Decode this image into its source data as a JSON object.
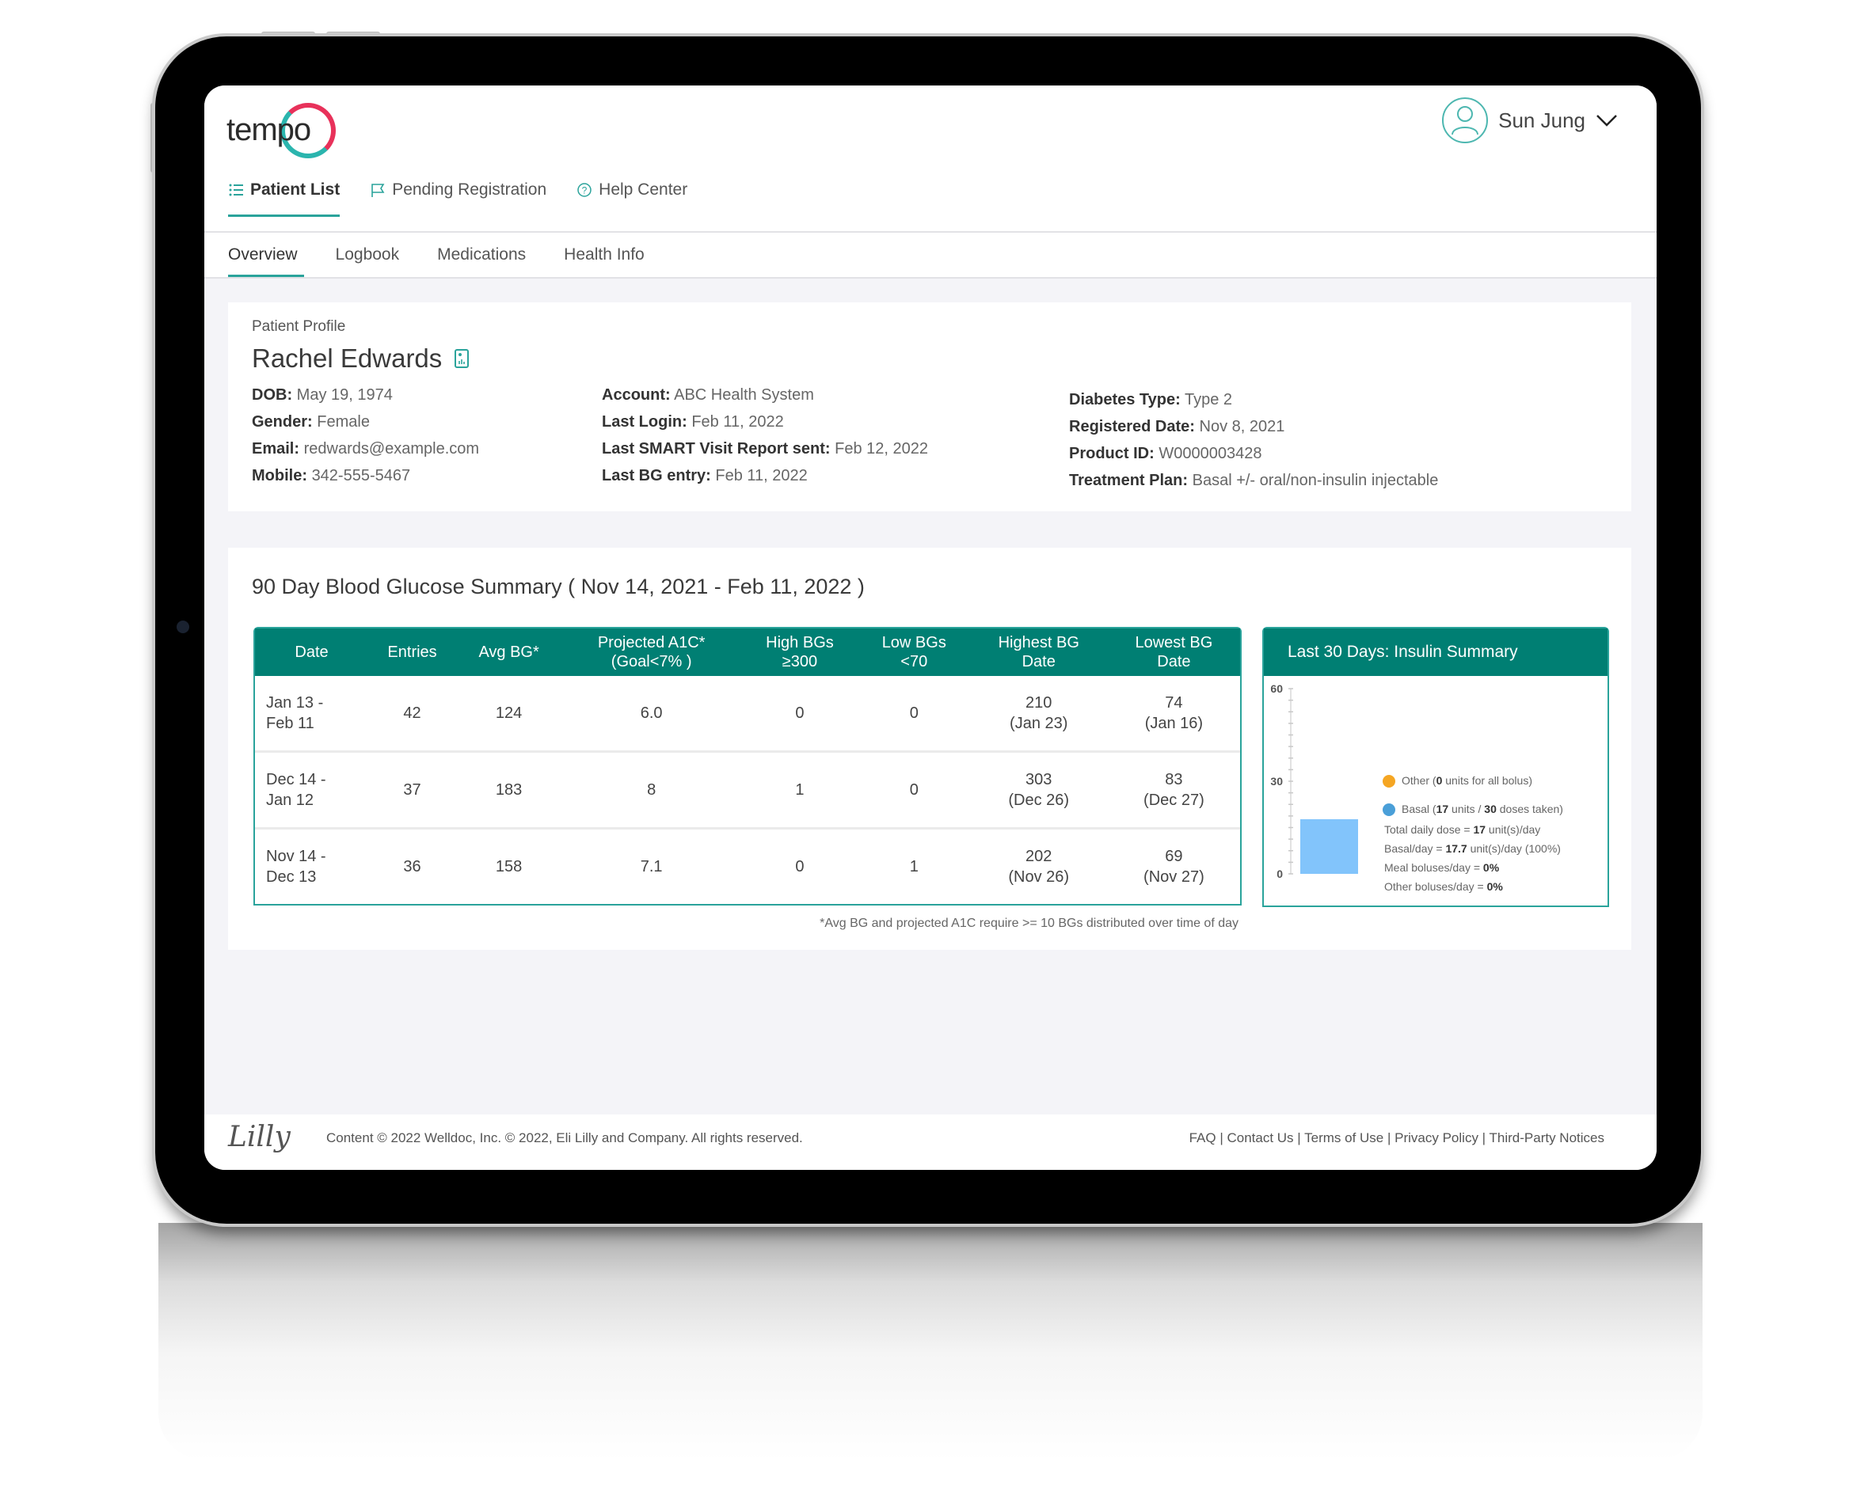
{
  "app": {
    "logo_text": "tempo",
    "user": {
      "name": "Sun Jung"
    }
  },
  "primary_nav": [
    {
      "label": "Patient List",
      "icon": "list-icon",
      "active": true
    },
    {
      "label": "Pending Registration",
      "icon": "flag-icon",
      "active": false
    },
    {
      "label": "Help Center",
      "icon": "help-circle-icon",
      "active": false
    }
  ],
  "sub_tabs": [
    {
      "label": "Overview",
      "active": true
    },
    {
      "label": "Logbook",
      "active": false
    },
    {
      "label": "Medications",
      "active": false
    },
    {
      "label": "Health Info",
      "active": false
    }
  ],
  "profile": {
    "section_label": "Patient Profile",
    "name": "Rachel Edwards",
    "col1": [
      {
        "label": "DOB:",
        "value": "May 19, 1974"
      },
      {
        "label": "Gender:",
        "value": "Female"
      },
      {
        "label": "Email:",
        "value": "redwards@example.com"
      },
      {
        "label": "Mobile:",
        "value": "342-555-5467"
      }
    ],
    "col2": [
      {
        "label": "Account:",
        "value": "ABC Health System"
      },
      {
        "label": "Last Login:",
        "value": "Feb 11, 2022"
      },
      {
        "label": "Last SMART Visit Report sent:",
        "value": "Feb 12, 2022"
      },
      {
        "label": "Last BG entry:",
        "value": "Feb 11, 2022"
      }
    ],
    "col3": [
      {
        "label": "Diabetes Type:",
        "value": "Type 2"
      },
      {
        "label": "Registered Date:",
        "value": "Nov 8, 2021"
      },
      {
        "label": "Product ID:",
        "value": "W0000003428"
      },
      {
        "label": "Treatment Plan:",
        "value": "Basal +/- oral/non-insulin injectable"
      }
    ]
  },
  "bg_summary": {
    "title": "90 Day Blood Glucose Summary ( Nov 14, 2021 - Feb 11, 2022 )",
    "headers": [
      "Date",
      "Entries",
      "Avg BG*",
      "Projected A1C*\n(Goal<7% )",
      "High BGs\n≥300",
      "Low BGs\n<70",
      "Highest BG\nDate",
      "Lowest BG\nDate"
    ],
    "rows": [
      [
        "Jan 13 -\nFeb 11",
        "42",
        "124",
        "6.0",
        "0",
        "0",
        "210\n(Jan 23)",
        "74\n(Jan 16)"
      ],
      [
        "Dec 14 -\nJan 12",
        "37",
        "183",
        "8",
        "1",
        "0",
        "303\n(Dec 26)",
        "83\n(Dec 27)"
      ],
      [
        "Nov 14 -\nDec 13",
        "36",
        "158",
        "7.1",
        "0",
        "1",
        "202\n(Nov 26)",
        "69\n(Nov 27)"
      ]
    ],
    "footnote": "*Avg BG and projected A1C require >= 10 BGs distributed over time of day"
  },
  "insulin_summary": {
    "title": "Last 30 Days: Insulin Summary",
    "legend": [
      {
        "name": "Other",
        "color": "#f5a623",
        "pre": "Other (",
        "bold": "0",
        "post": " units for all bolus)"
      },
      {
        "name": "Basal",
        "color": "#4a9fd8",
        "pre": "Basal (",
        "bold": "17",
        "mid": " units / ",
        "bold2": "30",
        "post": " doses taken)"
      }
    ],
    "stats": [
      {
        "pre": "Total daily dose = ",
        "bold": "17",
        "post": " unit(s)/day"
      },
      {
        "pre": "Basal/day = ",
        "bold": "17.7",
        "post": " unit(s)/day (100%)"
      },
      {
        "pre": "Meal boluses/day = ",
        "bold": "0%",
        "post": ""
      },
      {
        "pre": "Other boluses/day = ",
        "bold": "0%",
        "post": ""
      }
    ]
  },
  "chart_data": {
    "type": "bar",
    "title": "Last 30 Days: Insulin Summary",
    "categories": [
      "Insulin"
    ],
    "series": [
      {
        "name": "Basal",
        "values": [
          17.7
        ],
        "color": "#82c4fb"
      },
      {
        "name": "Other",
        "values": [
          0
        ],
        "color": "#f5a623"
      }
    ],
    "yticks": [
      0,
      30,
      60
    ],
    "ylim": [
      0,
      60
    ],
    "xlabel": "",
    "ylabel": "",
    "legend": "right"
  },
  "footer": {
    "brand": "Lilly",
    "copyright": "Content © 2022 Welldoc, Inc. © 2022, Eli Lilly and Company. All rights reserved.",
    "links": [
      "FAQ",
      "Contact Us",
      "Terms of Use",
      "Privacy Policy",
      "Third-Party Notices"
    ]
  },
  "colors": {
    "accent": "#2aa39b",
    "header_teal": "#007f73",
    "basal_bar": "#82c4fb",
    "other_dot": "#f5a623",
    "basal_dot": "#4a9fd8"
  }
}
